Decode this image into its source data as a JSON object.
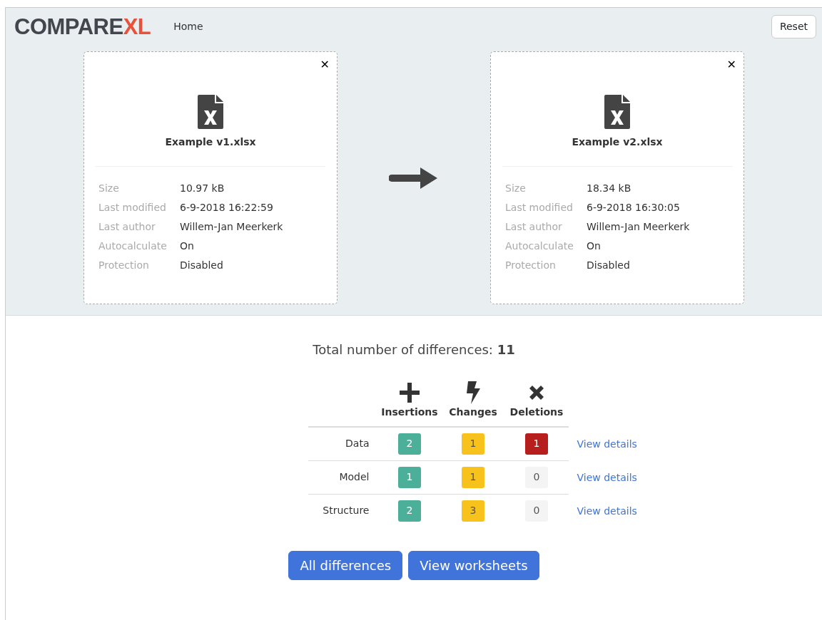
{
  "navbar": {
    "logo": {
      "main": "COMPARE",
      "accent": "XL"
    },
    "links": [
      "Home"
    ],
    "reset_button": "Reset"
  },
  "files": [
    {
      "name": "Example v1.xlsx",
      "close": "✕",
      "properties": [
        {
          "label": "Size",
          "value": "10.97 kB"
        },
        {
          "label": "Last modified",
          "value": "6-9-2018 16:22:59"
        },
        {
          "label": "Last author",
          "value": "Willem-Jan Meerkerk"
        },
        {
          "label": "Autocalculate",
          "value": "On"
        },
        {
          "label": "Protection",
          "value": "Disabled"
        }
      ]
    },
    {
      "name": "Example v2.xlsx",
      "close": "✕",
      "properties": [
        {
          "label": "Size",
          "value": "18.34 kB"
        },
        {
          "label": "Last modified",
          "value": "6-9-2018 16:30:05"
        },
        {
          "label": "Last author",
          "value": "Willem-Jan Meerkerk"
        },
        {
          "label": "Autocalculate",
          "value": "On"
        },
        {
          "label": "Protection",
          "value": "Disabled"
        }
      ]
    }
  ],
  "summary": {
    "label": "Total number of differences: ",
    "total": "11"
  },
  "table": {
    "columns": [
      {
        "kind": "insert",
        "label": "Insertions"
      },
      {
        "kind": "change",
        "label": "Changes"
      },
      {
        "kind": "delete",
        "label": "Deletions"
      }
    ],
    "rows": [
      {
        "label": "Data",
        "counts": [
          {
            "value": "2",
            "color": "#4caf9a"
          },
          {
            "value": "1",
            "color": "#f8c21c"
          },
          {
            "value": "1",
            "color": "#b71f1f"
          }
        ],
        "link": "View details"
      },
      {
        "label": "Model",
        "counts": [
          {
            "value": "1",
            "color": "#4caf9a"
          },
          {
            "value": "1",
            "color": "#f8c21c"
          },
          {
            "value": "0",
            "color": "#f4f4f4"
          }
        ],
        "link": "View details"
      },
      {
        "label": "Structure",
        "counts": [
          {
            "value": "2",
            "color": "#4caf9a"
          },
          {
            "value": "3",
            "color": "#f8c21c"
          },
          {
            "value": "0",
            "color": "#f4f4f4"
          }
        ],
        "link": "View details"
      }
    ]
  },
  "buttons": [
    "All differences",
    "View worksheets"
  ]
}
